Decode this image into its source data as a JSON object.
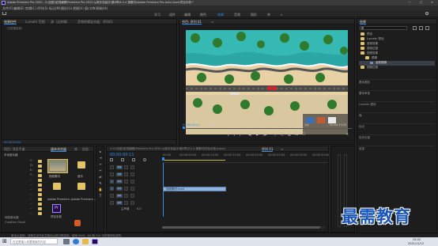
{
  "titlebar": {
    "title": "Adobe Premiere Pro 2020 - D:\\回蛇\\影视编辑\\Premiere Pro 2020 从新手到高手\\第8章\\8.2.4 源素材\\Adobe Premiere Pro Auto-Save\\项目手册 *",
    "controls": [
      "─",
      "□",
      "✕"
    ]
  },
  "menu": [
    "文件(F)",
    "编辑(E)",
    "剪辑(C)",
    "序列(S)",
    "标记(M)",
    "图形(G)",
    "视图(V)",
    "窗口(W)",
    "帮助(H)"
  ],
  "workspaces": {
    "items": [
      "学习",
      "组件",
      "编辑",
      "颜色",
      "效果",
      "音频",
      "图形",
      "库"
    ],
    "active_index": 4,
    "more": "»"
  },
  "source_panel": {
    "tabs": [
      "效果控件",
      "Lumetri 范围",
      "源（无剪辑）",
      "音频剪辑混合器：序列01"
    ],
    "message": "（无剪辑选择）",
    "timecode": "00:00:00:00"
  },
  "program_panel": {
    "tab": "节目: 序列 01",
    "menu_icon": "≡",
    "timecode_left": "00:00:00:11",
    "fit": "适合",
    "resolution": "1/4",
    "timecode_right": "00:00:13:23",
    "image_alt": "beach aerial",
    "transport": [
      "{",
      "}",
      "|←",
      "◀|",
      "▶",
      "|▶",
      "→|",
      "⎘",
      "⎙",
      "⊡",
      "⎔",
      "+"
    ]
  },
  "effects_panel": {
    "title": "效果",
    "search_placeholder": "",
    "items": [
      {
        "label": "预设",
        "indent": 0
      },
      {
        "label": "Lumetri 预设",
        "indent": 0
      },
      {
        "label": "音频效果",
        "indent": 0
      },
      {
        "label": "音频过渡",
        "indent": 0
      },
      {
        "label": "视频效果",
        "indent": 0
      },
      {
        "label": "模糊",
        "indent": 1
      },
      {
        "label": "高斯模糊",
        "indent": 2,
        "selected": true
      },
      {
        "label": "视频过渡",
        "indent": 0
      }
    ],
    "sections": [
      "基本图形",
      "基本声音",
      "Lumetri 颜色",
      "库",
      "标记",
      "历史记录",
      "信息"
    ]
  },
  "project_panel": {
    "tabs": [
      "项目: 项目手册",
      "媒体浏览器",
      "库",
      "信息"
    ],
    "active_tab": 1,
    "drive": "本地驱动器",
    "tree": [
      "C:",
      "D:",
      "E:",
      "F:",
      "…",
      "…",
      "…",
      "…",
      "…",
      "…",
      "…",
      "…",
      "网络驱动器",
      "Creative Cloud"
    ],
    "grid": [
      {
        "label": "视频素材",
        "kind": "thumb"
      },
      {
        "label": "音乐",
        "kind": "folder"
      },
      {
        "label": "Adobe Premiere…",
        "kind": "folder"
      },
      {
        "label": "Adobe Premiere…",
        "kind": "folder"
      },
      {
        "label": "项目手册",
        "kind": "pr"
      }
    ]
  },
  "tools": [
    "▸",
    "⇥",
    "⇿",
    "✂",
    "⇄",
    "✎",
    "✋",
    "T"
  ],
  "timeline": {
    "tab": "序列 01",
    "menu_icon": "≡",
    "path": "× D:\\回蛇\\影视编辑\\Premiere Pro 2020 从新手到高手\\第8章\\8.2.4 源素材\\项目手册.prproj",
    "timecode": "00:00:00:11",
    "ruler": [
      "00:00",
      "00:00:05:00",
      "00:00:10:00",
      "00:00:15:00",
      "00:00:20:00",
      "00:00:25:00",
      "00:00:30:00",
      "00:00:35:00"
    ],
    "tracks": [
      "V3",
      "V2",
      "V1",
      "A1",
      "A2",
      "A3"
    ],
    "master": "主声道",
    "master_value": "0.0",
    "clip_label": "视频素材.mp4"
  },
  "watermark": "最需教育",
  "status": {
    "text": "单击以选择，或单击空白处并拖动以进行框选择。使用 Shift、Alt 和 Ctrl 可获得其他选项。"
  },
  "taskbar": {
    "start": "⊞",
    "search_placeholder": "在这里输入你要搜索的内容",
    "time": "15:02",
    "date": "2021/11/12"
  },
  "colors": {
    "accent": "#2d8ceb",
    "timecode": "#2d8ceb",
    "clip": "#8fb4e0",
    "watermark": "#1a56b8",
    "folder": "#e3c368",
    "selected_row": "#3a3f4a"
  }
}
